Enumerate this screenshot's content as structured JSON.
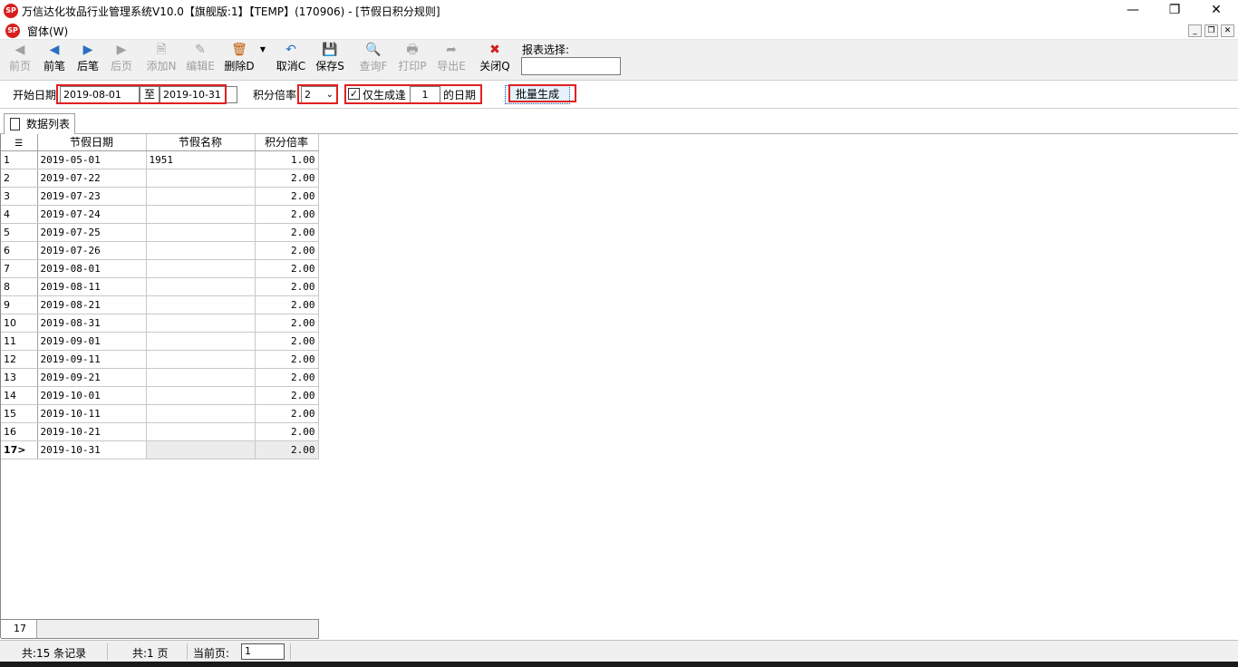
{
  "window": {
    "title": "万信达化妆品行业管理系统V10.0【旗舰版:1】【TEMP】(170906) - [节假日积分规则]",
    "logo_text": "SP",
    "minimize_icon": "minimize-icon",
    "maximize_icon": "restore-icon",
    "close_icon": "close-icon"
  },
  "menu": {
    "item": "窗体(W)"
  },
  "toolbar": {
    "buttons": [
      {
        "label": "前页",
        "icon": "first-page-icon",
        "enabled": false
      },
      {
        "label": "前笔",
        "icon": "prev-icon",
        "enabled": true
      },
      {
        "label": "后笔",
        "icon": "next-icon",
        "enabled": true
      },
      {
        "label": "后页",
        "icon": "last-page-icon",
        "enabled": false
      },
      {
        "label": "添加N",
        "icon": "add-icon",
        "enabled": false
      },
      {
        "label": "编辑E",
        "icon": "edit-icon",
        "enabled": false
      },
      {
        "label": "删除D",
        "icon": "delete-icon",
        "enabled": true
      },
      {
        "label": "取消C",
        "icon": "undo-icon",
        "enabled": true
      },
      {
        "label": "保存S",
        "icon": "save-icon",
        "enabled": true
      },
      {
        "label": "查询F",
        "icon": "query-icon",
        "enabled": false
      },
      {
        "label": "打印P",
        "icon": "print-icon",
        "enabled": false
      },
      {
        "label": "导出E",
        "icon": "export-icon",
        "enabled": false
      },
      {
        "label": "关闭Q",
        "icon": "close-x-icon",
        "enabled": true
      }
    ],
    "report_label": "报表选择:",
    "report_value": ""
  },
  "filter": {
    "start_date_label": "开始日期",
    "start_date": "2019-08-01",
    "to_label": "至",
    "end_date": "2019-10-31",
    "multiplier_label": "积分倍率",
    "multiplier_value": "2",
    "only_label": "仅生成逢",
    "only_checked": true,
    "day_value": "1",
    "day_suffix": "的日期",
    "batch_button": "批量生成"
  },
  "tab": {
    "label": "数据列表"
  },
  "grid": {
    "columns": [
      "节假日期",
      "节假名称",
      "积分倍率"
    ],
    "rows": [
      {
        "no": "1",
        "date": "2019-05-01",
        "name": "1951",
        "rate": "1.00"
      },
      {
        "no": "2",
        "date": "2019-07-22",
        "name": "",
        "rate": "2.00"
      },
      {
        "no": "3",
        "date": "2019-07-23",
        "name": "",
        "rate": "2.00"
      },
      {
        "no": "4",
        "date": "2019-07-24",
        "name": "",
        "rate": "2.00"
      },
      {
        "no": "5",
        "date": "2019-07-25",
        "name": "",
        "rate": "2.00"
      },
      {
        "no": "6",
        "date": "2019-07-26",
        "name": "",
        "rate": "2.00"
      },
      {
        "no": "7",
        "date": "2019-08-01",
        "name": "",
        "rate": "2.00"
      },
      {
        "no": "8",
        "date": "2019-08-11",
        "name": "",
        "rate": "2.00"
      },
      {
        "no": "9",
        "date": "2019-08-21",
        "name": "",
        "rate": "2.00"
      },
      {
        "no": "10",
        "date": "2019-08-31",
        "name": "",
        "rate": "2.00"
      },
      {
        "no": "11",
        "date": "2019-09-01",
        "name": "",
        "rate": "2.00"
      },
      {
        "no": "12",
        "date": "2019-09-11",
        "name": "",
        "rate": "2.00"
      },
      {
        "no": "13",
        "date": "2019-09-21",
        "name": "",
        "rate": "2.00"
      },
      {
        "no": "14",
        "date": "2019-10-01",
        "name": "",
        "rate": "2.00"
      },
      {
        "no": "15",
        "date": "2019-10-11",
        "name": "",
        "rate": "2.00"
      },
      {
        "no": "16",
        "date": "2019-10-21",
        "name": "",
        "rate": "2.00"
      },
      {
        "no": "17>",
        "date": "2019-10-31",
        "name": "",
        "rate": "2.00"
      }
    ],
    "footer_count": "17"
  },
  "status": {
    "records": "共:15 条记录",
    "pages": "共:1 页",
    "current_page_label": "当前页:",
    "current_page": "1"
  }
}
